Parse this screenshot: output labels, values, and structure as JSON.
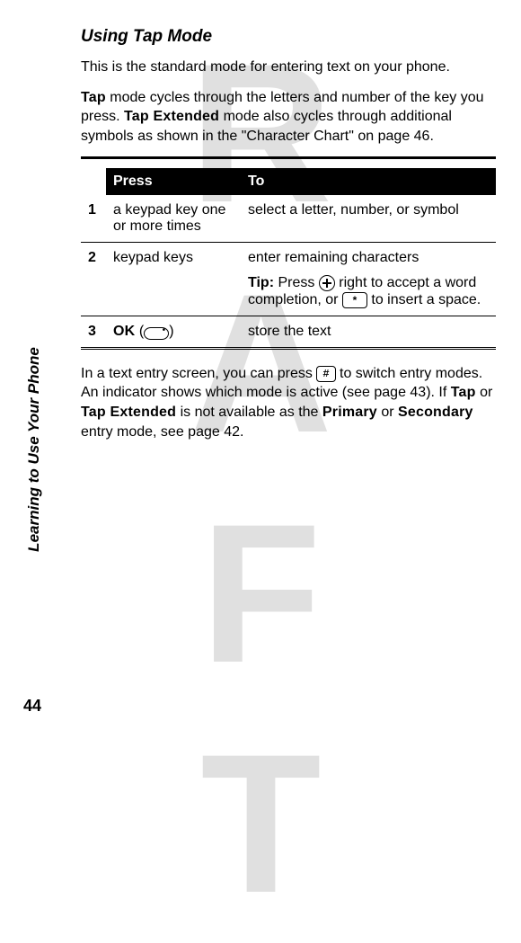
{
  "watermark": "DRAFT",
  "sidebar_label": "Learning to Use Your Phone",
  "page_number": "44",
  "heading": "Using Tap Mode",
  "para1": "This is the standard mode for entering text on your phone.",
  "para2_parts": {
    "a": "Tap",
    "b": " mode cycles through the letters and number of the key you press. ",
    "c": "Tap Extended",
    "d": " mode also cycles through additional symbols as shown in the \"Character Chart\" on page 46."
  },
  "table": {
    "headers": {
      "press": "Press",
      "to": "To"
    },
    "rows": [
      {
        "num": "1",
        "press": "a keypad key one or more times",
        "to": "select a letter, number, or symbol"
      },
      {
        "num": "2",
        "press": "keypad keys",
        "to_main": "enter remaining characters",
        "tip_label": "Tip:",
        "tip_a": " Press ",
        "tip_b": " right to accept a word completion, or ",
        "tip_c": " to insert a space."
      },
      {
        "num": "3",
        "press_bold": "OK",
        "press_paren_open": " (",
        "press_paren_close": ")",
        "to": "store the text"
      }
    ]
  },
  "para3_parts": {
    "a": "In a text entry screen, you can press ",
    "b": " to switch entry modes. An indicator shows which mode is active (see page 43). If ",
    "c": "Tap",
    "d": " or ",
    "e": "Tap Extended",
    "f": " is not available as the ",
    "g": "Primary",
    "h": " or ",
    "i": "Secondary",
    "j": " entry mode, see page 42."
  },
  "icons": {
    "nav": "navigation-key",
    "space": "*",
    "hash": "#",
    "softkey": "soft-key"
  }
}
